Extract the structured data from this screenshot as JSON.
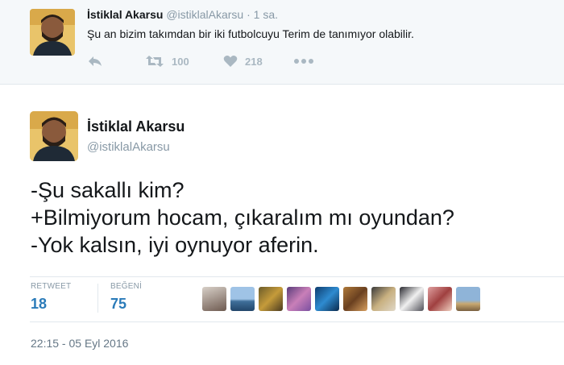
{
  "top_tweet": {
    "author_name": "İstiklal Akarsu",
    "handle": "@istiklalAkarsu",
    "separator": "·",
    "time": "1 sa.",
    "text": "Şu an bizim takımdan bir iki futbolcuyu Terim de tanımıyor olabilir.",
    "retweet_count": "100",
    "like_count": "218",
    "icons": [
      "reply-icon",
      "retweet-icon",
      "heart-icon",
      "more-icon"
    ]
  },
  "main_tweet": {
    "author_name": "İstiklal Akarsu",
    "handle": "@istiklalAkarsu",
    "lines": [
      "-Şu sakallı kim?",
      "+Bilmiyorum hocam, çıkaralım mı oyundan?",
      "-Yok kalsın, iyi oynuyor aferin."
    ],
    "stats": {
      "retweet_label": "RETWEET",
      "retweet_count": "18",
      "like_label": "BEĞENİ",
      "like_count": "75"
    },
    "likers_count_shown": 10,
    "timestamp": "22:15 - 05 Eyl 2016"
  },
  "colors": {
    "accent": "#2b7bb9",
    "muted": "#8899a6",
    "icon": "#aab8c2",
    "top_bg": "#f5f8fa",
    "avatar_bg": "#e9c46a"
  }
}
